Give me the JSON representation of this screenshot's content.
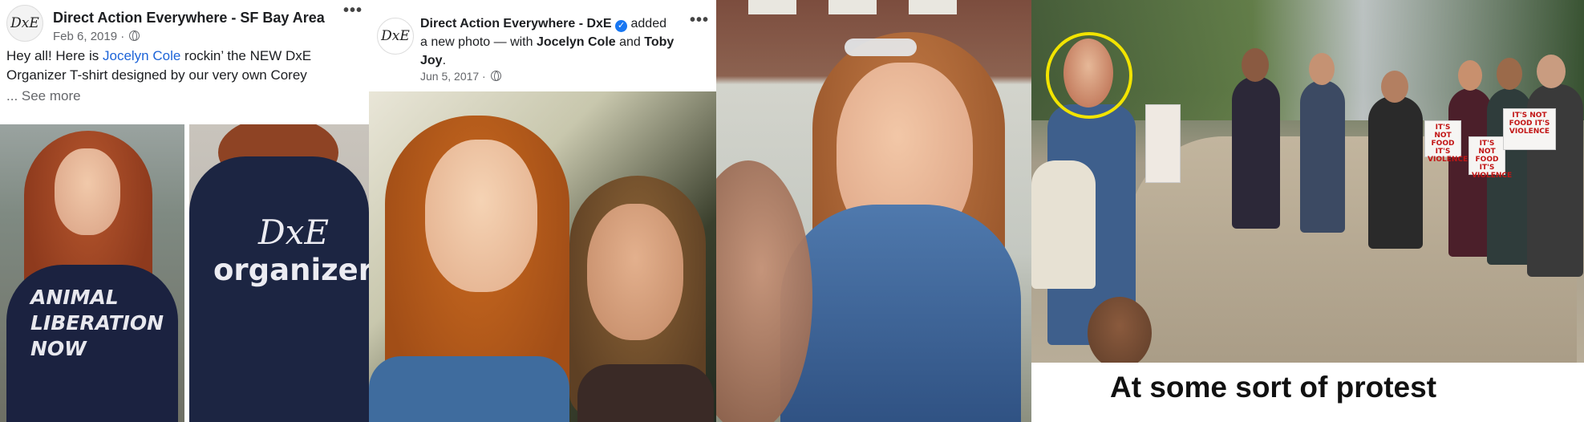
{
  "post1": {
    "avatar_text": "DxE",
    "page_name": "Direct Action Everywhere - SF Bay Area",
    "date": "Feb 6, 2019 ·",
    "text_before_link": "Hey all! Here is ",
    "tagged_person": "Jocelyn Cole",
    "text_after_link": " rockin’ the NEW DxE Organizer T-shirt designed by our very own Corey",
    "see_more": "... See more",
    "shirt_front_print": "ANIMAL LIBERATION NOW",
    "shirt_back_logo": "DxE",
    "shirt_back_text": "organizer",
    "more_icon": "more-options-icon",
    "privacy_icon": "globe-icon"
  },
  "post2": {
    "avatar_text": "DxE",
    "page_name": "Direct Action Everywhere - DxE",
    "verified_icon": "verified-badge-icon",
    "action_text": " added a new photo — with ",
    "tagged_1": "Jocelyn Cole",
    "and_text": " and ",
    "tagged_2": "Toby Joy",
    "period": ".",
    "date": "Jun 5, 2017 ·",
    "more_icon": "more-options-icon",
    "privacy_icon": "globe-icon"
  },
  "protest": {
    "signs": [
      "IT'S NOT FOOD IT'S VIOLENCE",
      "IT'S NOT FOOD IT'S VIOLENCE",
      "IT'S NOT FOOD IT'S VIOLENCE"
    ],
    "caption": "At some sort of protest",
    "highlight_color": "#f2e400"
  },
  "colors": {
    "link": "#1d64d8",
    "text": "#1c1e21",
    "meta": "#65676b",
    "verified": "#1877f2"
  }
}
